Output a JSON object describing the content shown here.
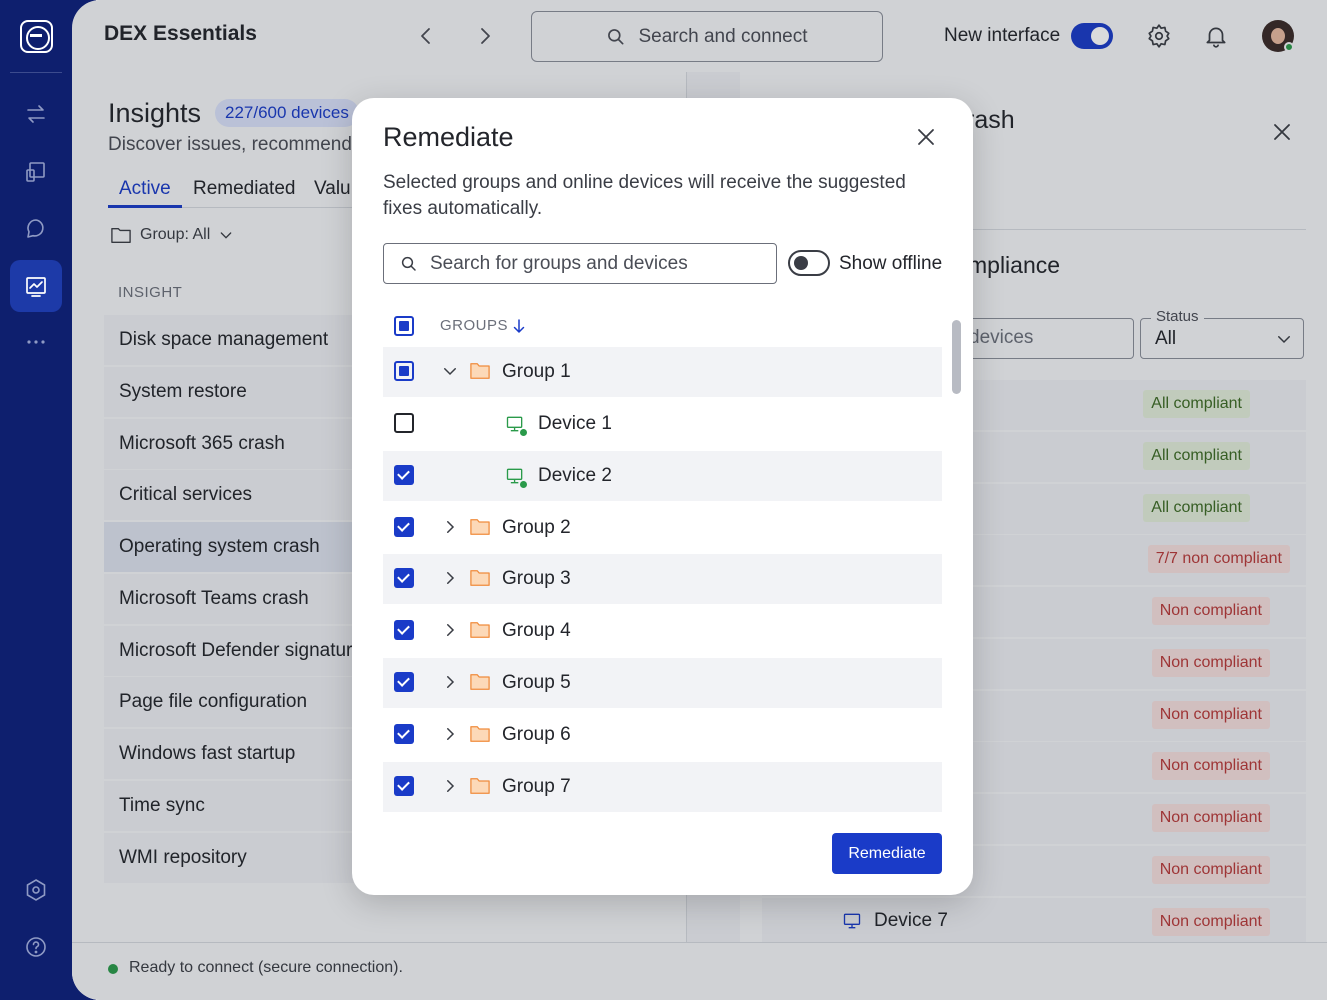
{
  "app": {
    "title": "DEX Essentials",
    "search_placeholder": "Search and connect",
    "new_interface_label": "New interface",
    "status_text": "Ready to connect (secure connection).",
    "accent": "#1a3bc8",
    "rail_color": "#0e1f6e"
  },
  "rail": {
    "items": [
      "connect-icon",
      "devices-icon",
      "chat-icon",
      "insights-icon",
      "more-icon",
      "settings-icon",
      "help-icon"
    ]
  },
  "insights": {
    "title": "Insights",
    "badge": "227/600 devices",
    "subtitle": "Discover issues, recommende",
    "tabs": [
      "Active",
      "Remediated",
      "Valu"
    ],
    "group_filter": "Group: All",
    "column_header": "INSIGHT",
    "rows": [
      "Disk space management",
      "System restore",
      "Microsoft 365 crash",
      "Critical services",
      "Operating system crash",
      "Microsoft Teams crash",
      "Microsoft Defender signatur",
      "Page file configuration",
      "Windows fast startup",
      "Time sync",
      "WMI repository"
    ],
    "selected_row": "Operating system crash"
  },
  "detail": {
    "title": "rash",
    "section_title": "mpliance",
    "search_placeholder": "devices",
    "status_label": "Status",
    "status_value": "All",
    "rows": [
      {
        "device": "",
        "status": "All compliant",
        "kind": "ok"
      },
      {
        "device": "",
        "status": "All compliant",
        "kind": "ok"
      },
      {
        "device": "",
        "status": "All compliant",
        "kind": "ok"
      },
      {
        "device": "",
        "status": "7/7 non compliant",
        "kind": "bad"
      },
      {
        "device": "",
        "status": "Non compliant",
        "kind": "bad"
      },
      {
        "device": "",
        "status": "Non compliant",
        "kind": "bad"
      },
      {
        "device": "",
        "status": "Non compliant",
        "kind": "bad"
      },
      {
        "device": "",
        "status": "Non compliant",
        "kind": "bad"
      },
      {
        "device": "",
        "status": "Non compliant",
        "kind": "bad"
      },
      {
        "device": "",
        "status": "Non compliant",
        "kind": "bad"
      },
      {
        "device": "Device 7",
        "status": "Non compliant",
        "kind": "bad"
      }
    ]
  },
  "modal": {
    "title": "Remediate",
    "description": "Selected groups and online devices will receive the suggested fixes automatically.",
    "search_placeholder": "Search for groups and devices",
    "show_offline_label": "Show offline",
    "show_offline": false,
    "groups_header": "GROUPS",
    "header_checkbox": "indeterminate",
    "tree": [
      {
        "type": "group",
        "name": "Group 1",
        "check": "indeterminate",
        "expanded": true
      },
      {
        "type": "device",
        "name": "Device 1",
        "check": "unchecked",
        "online": true
      },
      {
        "type": "device",
        "name": "Device 2",
        "check": "checked",
        "online": true
      },
      {
        "type": "group",
        "name": "Group 2",
        "check": "checked",
        "expanded": false
      },
      {
        "type": "group",
        "name": "Group 3",
        "check": "checked",
        "expanded": false
      },
      {
        "type": "group",
        "name": "Group 4",
        "check": "checked",
        "expanded": false
      },
      {
        "type": "group",
        "name": "Group 5",
        "check": "checked",
        "expanded": false
      },
      {
        "type": "group",
        "name": "Group 6",
        "check": "checked",
        "expanded": false
      },
      {
        "type": "group",
        "name": "Group 7",
        "check": "checked",
        "expanded": false
      }
    ],
    "button_label": "Remediate"
  }
}
